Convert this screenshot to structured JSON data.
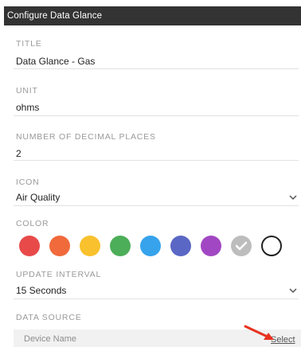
{
  "dialog": {
    "title": "Configure Data Glance"
  },
  "fields": {
    "title": {
      "label": "TITLE",
      "value": "Data Glance - Gas"
    },
    "unit": {
      "label": "UNIT",
      "value": "ohms"
    },
    "decimals": {
      "label": "NUMBER OF DECIMAL PLACES",
      "value": "2"
    },
    "icon": {
      "label": "ICON",
      "value": "Air Quality"
    },
    "color": {
      "label": "COLOR",
      "swatches": [
        {
          "name": "red",
          "color": "#e84a4a"
        },
        {
          "name": "orange",
          "color": "#f06a3b"
        },
        {
          "name": "yellow",
          "color": "#f8c12d"
        },
        {
          "name": "green",
          "color": "#4cae58"
        },
        {
          "name": "blue",
          "color": "#36a3ec"
        },
        {
          "name": "indigo",
          "color": "#5a67c4"
        },
        {
          "name": "purple",
          "color": "#a247c3"
        },
        {
          "name": "gray-checked",
          "color": "#bdbdbd",
          "icon": "check-icon"
        },
        {
          "name": "white-outline",
          "color": "#ffffff"
        }
      ]
    },
    "interval": {
      "label": "UPDATE INTERVAL",
      "value": "15 Seconds"
    },
    "data_source": {
      "label": "DATA SOURCE",
      "device_name_label": "Device Name",
      "select_label": "Select"
    }
  },
  "annotation": {
    "arrow_color": "#e8321f"
  }
}
